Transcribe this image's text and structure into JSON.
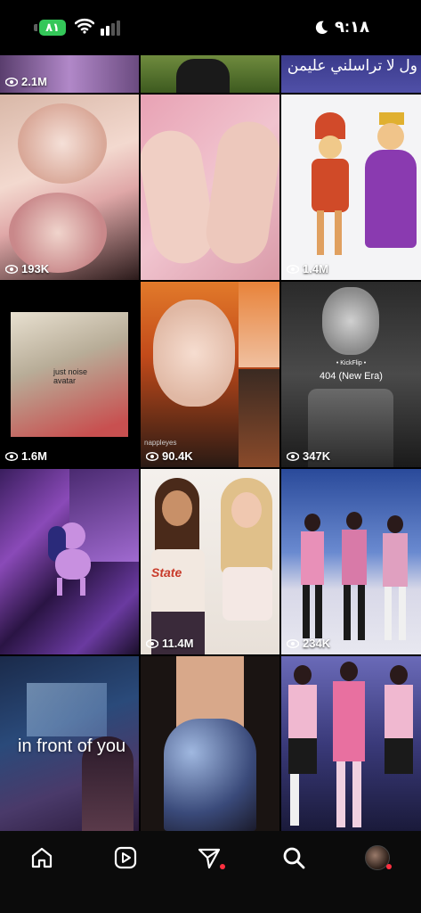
{
  "status_bar": {
    "battery": "٨١",
    "time": "٩:١٨"
  },
  "tiles": [
    {
      "id": "r0c0",
      "views": "2.1M"
    },
    {
      "id": "r0c1",
      "views": ""
    },
    {
      "id": "r0c2",
      "views": "",
      "caption": "ول لا تراسلني عليمن"
    },
    {
      "id": "r1c0",
      "views": "193K"
    },
    {
      "id": "r1c1",
      "views": ""
    },
    {
      "id": "r1c2",
      "views": "1.4M"
    },
    {
      "id": "r2c0",
      "views": "1.6M",
      "overlay": "just noise\navatar"
    },
    {
      "id": "r2c1",
      "views": "90.4K",
      "overlay": "nappleyes"
    },
    {
      "id": "r2c2",
      "views": "347K",
      "top": "• KickFlip •",
      "sub": "404 (New Era)"
    },
    {
      "id": "r3c0",
      "views": ""
    },
    {
      "id": "r3c1",
      "views": "11.4M",
      "shirt": "State"
    },
    {
      "id": "r3c2",
      "views": "234K"
    },
    {
      "id": "r4c0",
      "views": "",
      "overlay_big": "in front of you"
    },
    {
      "id": "r4c1",
      "views": ""
    },
    {
      "id": "r4c2",
      "views": ""
    }
  ],
  "tab_bar": {
    "items": [
      "home",
      "reels",
      "messages",
      "search",
      "profile"
    ]
  }
}
